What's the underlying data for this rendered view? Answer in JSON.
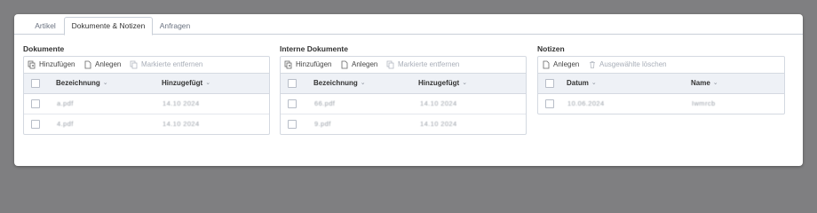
{
  "tabs": [
    {
      "label": "Artikel",
      "active": false
    },
    {
      "label": "Dokumente & Notizen",
      "active": true
    },
    {
      "label": "Anfragen",
      "active": false
    }
  ],
  "dokumente": {
    "title": "Dokumente",
    "toolbar": {
      "add": "Hinzufügen",
      "create": "Anlegen",
      "remove": "Markierte entfernen"
    },
    "columns": [
      "Bezeichnung",
      "Hinzugefügt"
    ],
    "rows": [
      {
        "name": "a.pdf",
        "date": "14.10 2024"
      },
      {
        "name": "4.pdf",
        "date": "14.10 2024"
      }
    ]
  },
  "interne": {
    "title": "Interne Dokumente",
    "toolbar": {
      "add": "Hinzufügen",
      "create": "Anlegen",
      "remove": "Markierte entfernen"
    },
    "columns": [
      "Bezeichnung",
      "Hinzugefügt"
    ],
    "rows": [
      {
        "name": "66.pdf",
        "date": "14.10 2024"
      },
      {
        "name": "9.pdf",
        "date": "14.10 2024"
      }
    ]
  },
  "notizen": {
    "title": "Notizen",
    "toolbar": {
      "create": "Anlegen",
      "remove": "Ausgewählte löschen"
    },
    "columns": [
      "Datum",
      "Name"
    ],
    "rows": [
      {
        "date": "10.06.2024",
        "name": "Iwmrcb"
      }
    ]
  },
  "colors": {
    "background": "#7f7f81",
    "header": "#eef1f6",
    "border": "#d4d9e1"
  }
}
